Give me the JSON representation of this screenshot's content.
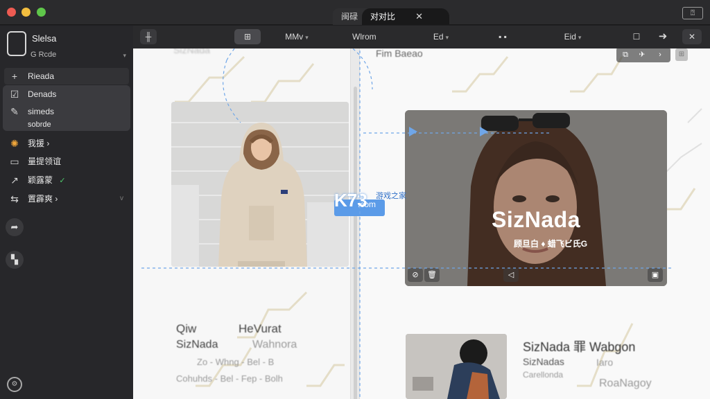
{
  "window": {
    "tabs": [
      {
        "label": "闽碌"
      },
      {
        "label": "对对比",
        "close": "✕"
      }
    ],
    "titlebar_button": "⍰"
  },
  "sidebar": {
    "header": {
      "title": "Slelsa",
      "subtitle": "G Rcde"
    },
    "items": [
      {
        "label": "Rieada",
        "icon": "plus-icon"
      },
      {
        "label": "Denads",
        "icon": "checkbox-icon"
      },
      {
        "label": "simeds",
        "icon": "pencil-icon"
      },
      {
        "label": "sobrde",
        "icon": ""
      },
      {
        "label": "我援 ›",
        "icon": "globe-icon"
      },
      {
        "label": "量提领谊",
        "icon": "monitor-icon"
      },
      {
        "label": "颖露蒙",
        "icon": "chart-icon",
        "badge": "✓"
      },
      {
        "label": "置霹爽 ›",
        "icon": "sliders-icon"
      }
    ],
    "extra_buttons": [
      "share-icon",
      "layers-icon"
    ],
    "settings_icon": "settings-icon"
  },
  "toolbar": {
    "items": [
      "╫",
      "⊞",
      "MMv",
      "Wlrom",
      "Ed",
      "▪ ▪",
      "Eid",
      "☐",
      "➜",
      "✕"
    ]
  },
  "canvas": {
    "ghost_top_left": "SizNada",
    "ghost_top_right": "Fim Baeao",
    "card_right": {
      "title": "SizNada",
      "subtitle": "顾旦白 ♦ 蜡飞ビ氏G"
    },
    "watermark": {
      "letters": "K73",
      "cn": "游戏之家",
      "domain": ".com"
    },
    "bottom_left": {
      "col1_title": "Qiw",
      "col2_title": "HeVurat",
      "row1_a": "SizNada",
      "row1_b": "Wahnora",
      "row2": "Zo - Whng - Bel - B",
      "row3": "Cohuhds - Bel - Fep - Bolh"
    },
    "bottom_right": {
      "title": "SizNada 罪 Wabgon",
      "line1": "SizNadas",
      "line1b": "Iaro",
      "line2": "Carellonda",
      "line3": "RoaNagoy"
    }
  }
}
